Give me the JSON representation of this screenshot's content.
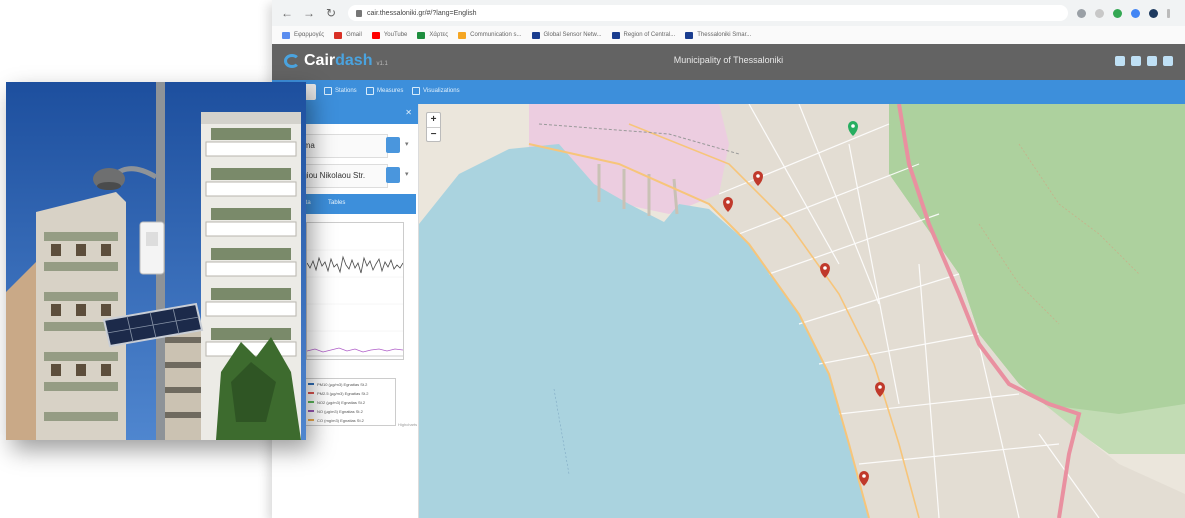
{
  "browser": {
    "url": "cair.thessaloniki.gr/#/?lang=English",
    "bookmarks": [
      {
        "label": "Εφαρμογές",
        "color": "#5b8def"
      },
      {
        "label": "Gmail",
        "color": "#d93025"
      },
      {
        "label": "YouTube",
        "color": "#ff0000"
      },
      {
        "label": "Χάρτες",
        "color": "#1e8e3e"
      },
      {
        "label": "Communication s...",
        "color": "#f5a623"
      },
      {
        "label": "Global Sensor Netw...",
        "color": "#1a3d8f"
      },
      {
        "label": "Region of Central...",
        "color": "#1a3d8f"
      },
      {
        "label": "Thessaloniki Smar...",
        "color": "#1a3d8f"
      }
    ]
  },
  "header": {
    "logo_part1": "Cair",
    "logo_part2": "dash",
    "version": "v1.1",
    "title": "Municipality of Thessaloniki"
  },
  "toolbar": {
    "items": [
      "Stations",
      "Measures",
      "Visualizations"
    ]
  },
  "side_panel": {
    "select_1": "...ma",
    "select_2": "Agiou Nikolaou Str.",
    "tabs": [
      "Data",
      "Tables"
    ],
    "legend": [
      {
        "label": "PM10 (µg/m3) Egnatias St.2",
        "color": "#2f6db5"
      },
      {
        "label": "PM2.5 (µg/m3) Egnatias St.2",
        "color": "#d9534f"
      },
      {
        "label": "NO2 (µg/m3) Egnatias St.2",
        "color": "#5cb85c"
      },
      {
        "label": "NO (µg/m3) Egnatias St.2",
        "color": "#9b59b6"
      },
      {
        "label": "CO (mg/m3) Egnatias St.2",
        "color": "#f0ad4e"
      }
    ],
    "credit": "Highcharts"
  },
  "map": {
    "zoom_in": "+",
    "zoom_out": "−",
    "sea_color": "#aad3df",
    "forest_color": "#add19e",
    "motorway_color": "#e990a0",
    "markers": [
      {
        "color": "#c0392b"
      },
      {
        "color": "#c0392b"
      },
      {
        "color": "#c0392b"
      },
      {
        "color": "#c0392b"
      },
      {
        "color": "#c0392b"
      },
      {
        "color": "#27ae60"
      }
    ]
  }
}
